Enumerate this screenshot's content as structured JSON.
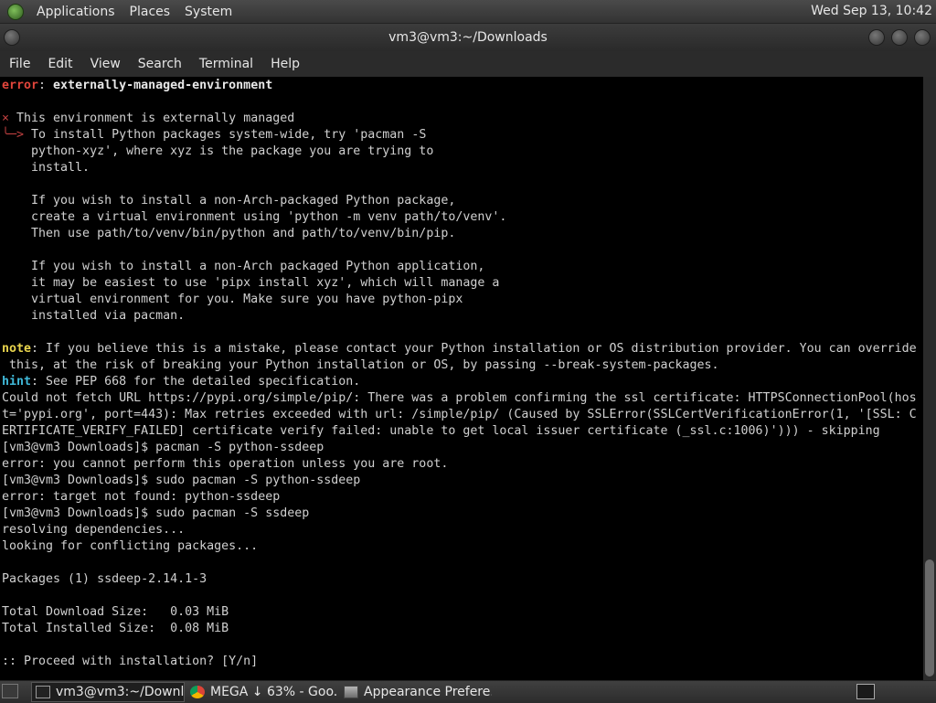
{
  "top_panel": {
    "menus": [
      "Applications",
      "Places",
      "System"
    ],
    "clock": "Wed Sep 13, 10:42"
  },
  "window": {
    "title": "vm3@vm3:~/Downloads",
    "menu": [
      "File",
      "Edit",
      "View",
      "Search",
      "Terminal",
      "Help"
    ]
  },
  "terminal": {
    "lines": [
      [
        {
          "t": "error",
          "c": "red"
        },
        {
          "t": ": "
        },
        {
          "t": "externally-managed-environment",
          "c": "bold"
        }
      ],
      [
        {
          "t": ""
        }
      ],
      [
        {
          "t": "×",
          "c": "dimred"
        },
        {
          "t": " This environment is externally managed"
        }
      ],
      [
        {
          "t": "╰─>",
          "c": "dimred"
        },
        {
          "t": " To install Python packages system-wide, try 'pacman -S"
        }
      ],
      [
        {
          "t": "    python-xyz', where xyz is the package you are trying to"
        }
      ],
      [
        {
          "t": "    install."
        }
      ],
      [
        {
          "t": ""
        }
      ],
      [
        {
          "t": "    If you wish to install a non-Arch-packaged Python package,"
        }
      ],
      [
        {
          "t": "    create a virtual environment using 'python -m venv path/to/venv'."
        }
      ],
      [
        {
          "t": "    Then use path/to/venv/bin/python and path/to/venv/bin/pip."
        }
      ],
      [
        {
          "t": ""
        }
      ],
      [
        {
          "t": "    If you wish to install a non-Arch packaged Python application,"
        }
      ],
      [
        {
          "t": "    it may be easiest to use 'pipx install xyz', which will manage a"
        }
      ],
      [
        {
          "t": "    virtual environment for you. Make sure you have python-pipx"
        }
      ],
      [
        {
          "t": "    installed via pacman."
        }
      ],
      [
        {
          "t": ""
        }
      ],
      [
        {
          "t": "note",
          "c": "mag"
        },
        {
          "t": ": If you believe this is a mistake, please contact your Python installation or OS distribution provider. You can override"
        }
      ],
      [
        {
          "t": " this, at the risk of breaking your Python installation or OS, by passing --break-system-packages."
        }
      ],
      [
        {
          "t": "hint",
          "c": "cyan"
        },
        {
          "t": ": See PEP 668 for the detailed specification."
        }
      ],
      [
        {
          "t": "Could not fetch URL https://pypi.org/simple/pip/: There was a problem confirming the ssl certificate: HTTPSConnectionPool(hos"
        }
      ],
      [
        {
          "t": "t='pypi.org', port=443): Max retries exceeded with url: /simple/pip/ (Caused by SSLError(SSLCertVerificationError(1, '[SSL: C"
        }
      ],
      [
        {
          "t": "ERTIFICATE_VERIFY_FAILED] certificate verify failed: unable to get local issuer certificate (_ssl.c:1006)'))) - skipping"
        }
      ],
      [
        {
          "t": "[vm3@vm3 Downloads]$ pacman -S python-ssdeep"
        }
      ],
      [
        {
          "t": "error: you cannot perform this operation unless you are root."
        }
      ],
      [
        {
          "t": "[vm3@vm3 Downloads]$ sudo pacman -S python-ssdeep"
        }
      ],
      [
        {
          "t": "error: target not found: python-ssdeep"
        }
      ],
      [
        {
          "t": "[vm3@vm3 Downloads]$ sudo pacman -S ssdeep"
        }
      ],
      [
        {
          "t": "resolving dependencies..."
        }
      ],
      [
        {
          "t": "looking for conflicting packages..."
        }
      ],
      [
        {
          "t": ""
        }
      ],
      [
        {
          "t": "Packages (1) ssdeep-2.14.1-3"
        }
      ],
      [
        {
          "t": ""
        }
      ],
      [
        {
          "t": "Total Download Size:   0.03 MiB"
        }
      ],
      [
        {
          "t": "Total Installed Size:  0.08 MiB"
        }
      ],
      [
        {
          "t": ""
        }
      ],
      [
        {
          "t": ":: Proceed with installation? [Y/n]"
        }
      ]
    ]
  },
  "taskbar": {
    "tasks": [
      {
        "label": "vm3@vm3:~/Downl...",
        "icon": "terminal-icon",
        "active": true
      },
      {
        "label": "MEGA ↓ 63% - Goo...",
        "icon": "chrome-icon",
        "active": false
      },
      {
        "label": "Appearance Prefere...",
        "icon": "appearance-icon",
        "active": false
      }
    ]
  }
}
